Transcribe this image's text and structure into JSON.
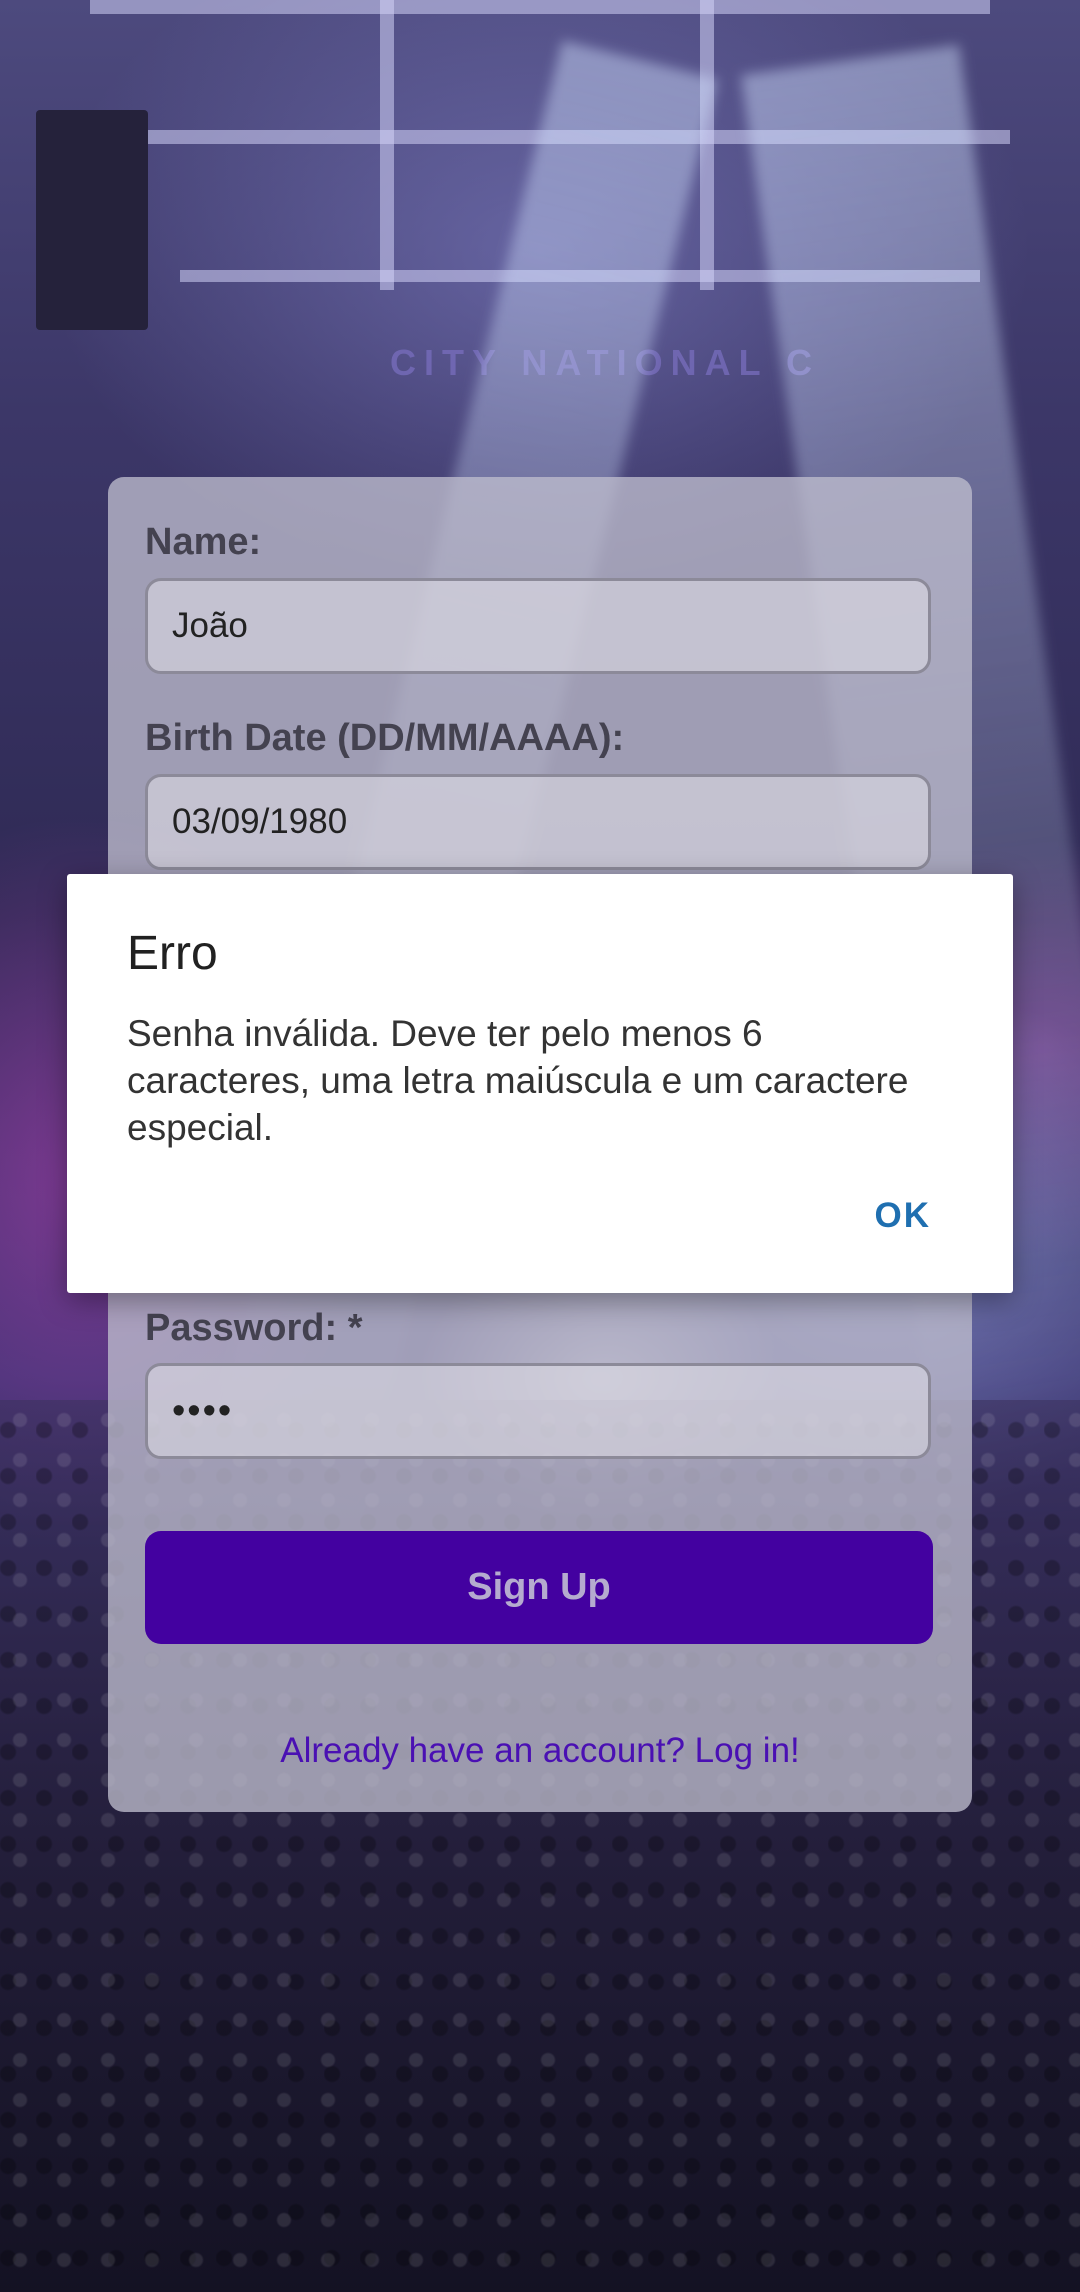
{
  "background": {
    "venue_sign": "CITY NATIONAL C"
  },
  "form": {
    "name_label": "Name:",
    "name_value": "João",
    "birth_label": "Birth Date (DD/MM/AAAA):",
    "birth_value": "03/09/1980",
    "password_label": "Password: *",
    "password_value": "••••",
    "signup_label": "Sign Up",
    "login_link": "Already have an account? Log in!"
  },
  "dialog": {
    "title": "Erro",
    "message": "Senha inválida. Deve ter pelo menos 6 caracteres, uma letra maiúscula e um caractere especial.",
    "ok_label": "OK"
  },
  "colors": {
    "primary": "#4301a0",
    "link": "#4a10b3",
    "dialog_accent": "#1f6fb0"
  }
}
